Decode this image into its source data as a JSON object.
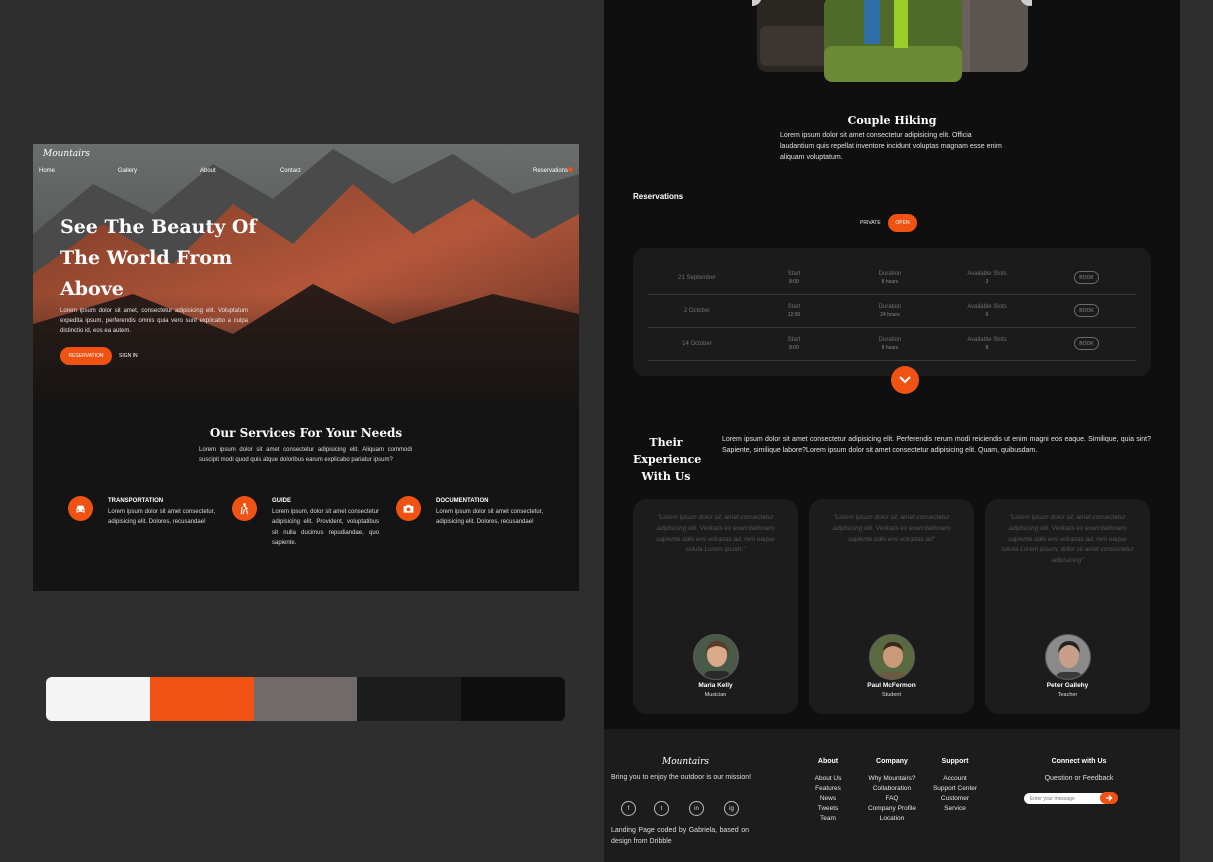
{
  "colors": {
    "accent": "#ef5212",
    "light": "#f4f4f4",
    "gray": "#706a6a",
    "dark": "#1c1c1c",
    "darkest": "#0f0f0f",
    "background": "#2e2e2e"
  },
  "hero": {
    "logo": "Mountairs",
    "nav": [
      "Home",
      "Gallery",
      "About",
      "Contact"
    ],
    "nav_right": "Reservations",
    "title": "See The Beauty Of The World From Above",
    "text": "Lorem ipsum dolor sit amet, consectetur adipisicing elit. Voluptatum expedita ipsum, perferendis omnis quia vero sunt explicabo a culpa distinctio id, eos ea autem.",
    "reservation_button": "RESERVATION",
    "signin_button": "SIGN IN"
  },
  "services": {
    "title": "Our Services For Your Needs",
    "text": "Lorem ipsum dolor sit amet consectetur adipisicing elit. Aliquam commodi suscipit modi quod quis atque doloribus earum explicabo pariatur ipsum?",
    "items": [
      {
        "icon": "car-icon",
        "title": "TRANSPORTATION",
        "text": "Lorem ipsum dolor sit amet consectetur, adipisicing elit. Dolores, recusandae!"
      },
      {
        "icon": "hiker-icon",
        "title": "GUIDE",
        "text": "Lorem ipsum, dolor sit amet consectetur adipisicing elit. Provident, voluptatibus sit nulla ducimus repudiandae, quo sapiente."
      },
      {
        "icon": "camera-icon",
        "title": "DOCUMENTATION",
        "text": "Lorem ipsum dolor sit amet consectetur, adipisicing elit. Dolores, recusandae!"
      }
    ]
  },
  "palette": [
    "#f4f4f4",
    "#ef5212",
    "#706a6a",
    "#1c1c1c",
    "#0f0f0f"
  ],
  "gallery": {
    "title": "Couple Hiking",
    "text": "Lorem ipsum dolor sit amet consectetur adipisicing elit. Officia laudantium quis repellat inventore incidunt voluptas magnam esse enim aliquam voluptatum."
  },
  "reservations": {
    "title": "Reservations",
    "toggle_private": "PRIVATE",
    "toggle_open": "OPEN",
    "rows": [
      {
        "date": "21 September",
        "start_label": "Start",
        "start": "8:00",
        "duration_label": "Duration",
        "duration": "8 hours",
        "slots_label": "Available Slots",
        "slots": "3",
        "book": "BOOK"
      },
      {
        "date": "2 October",
        "start_label": "Start",
        "start": "12:00",
        "duration_label": "Duration",
        "duration": "24 hours",
        "slots_label": "Available Slots",
        "slots": "6",
        "book": "BOOK"
      },
      {
        "date": "14 October",
        "start_label": "Start",
        "start": "8:00",
        "duration_label": "Duration",
        "duration": "8 hours",
        "slots_label": "Available Slots",
        "slots": "8",
        "book": "BOOK"
      }
    ]
  },
  "experience": {
    "title": "Their Experience With Us",
    "text": "Lorem ipsum dolor sit amet consectetur adipisicing elit. Perferendis rerum modi reiciendis ut enim magni eos eaque. Similique, quia sint? Sapiente, similique labore?Lorem ipsum dolor sit amet consectetur adipisicing elit. Quam, quibusdam.",
    "testimonials": [
      {
        "quote": "\"Lorem ipsum dolor sit, amet consectetur adipisicing elit. Veritatis ex exercitationem sapiente odio eos voluptas ad, rem eaque soluta Lorem ipsum.\"",
        "name": "Maria Kelly",
        "role": "Musician"
      },
      {
        "quote": "\"Lorem ipsum dolor sit, amet consectetur adipisicing elit. Veritatis ex exercitationem sapiente odio eos voluptas ad\"",
        "name": "Paul McFermon",
        "role": "Student"
      },
      {
        "quote": "\"Lorem ipsum dolor sit, amet consectetur adipisicing elit. Veritatis ex exercitationem sapiente odio eos voluptas ad, rem eaque soluta Lorem ipsum, dolor sit amet consectetur adipisicing\"",
        "name": "Peter Gallehy",
        "role": "Teacher"
      }
    ]
  },
  "footer": {
    "logo": "Mountairs",
    "tagline": "Bring you to enjoy the outdoor is our mission!",
    "socials": [
      "f",
      "t",
      "in",
      "ig"
    ],
    "credit": "Landing Page coded by Gabriela, based on design from Dribble",
    "columns": [
      {
        "title": "About",
        "items": [
          "About Us",
          "Features",
          "News",
          "Tweets",
          "Team"
        ]
      },
      {
        "title": "Company",
        "items": [
          "Why Mountairs?",
          "Collaboration",
          "FAQ",
          "Company Profile",
          "Location"
        ]
      },
      {
        "title": "Support",
        "items": [
          "Account",
          "Support Center",
          "Customer",
          "Service"
        ]
      }
    ],
    "connect_title": "Connect with Us",
    "feedback": "Question or Feedback",
    "input_placeholder": "Enter your message"
  }
}
